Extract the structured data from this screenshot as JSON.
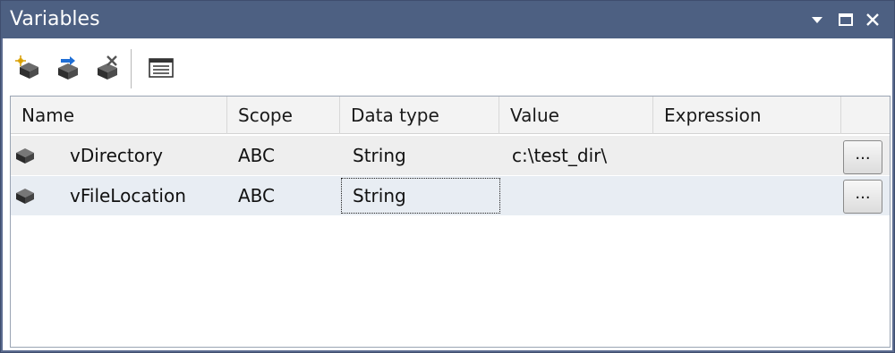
{
  "window": {
    "title": "Variables",
    "title_buttons": [
      "dropdown-arrow",
      "maximize",
      "close"
    ]
  },
  "toolbar": {
    "buttons": [
      {
        "icon": "add-variable-icon"
      },
      {
        "icon": "move-variable-icon"
      },
      {
        "icon": "delete-variable-icon"
      },
      {
        "icon": "grid-options-icon"
      }
    ]
  },
  "grid": {
    "columns": [
      "Name",
      "Scope",
      "Data type",
      "Value",
      "Expression"
    ],
    "rows": [
      {
        "icon": "variable-icon",
        "name": "vDirectory",
        "scope": "ABC",
        "data_type": "String",
        "value": "c:\\test_dir\\",
        "expression": "",
        "button": "..."
      },
      {
        "icon": "variable-icon",
        "name": "vFileLocation",
        "scope": "ABC",
        "data_type": "String",
        "value": "",
        "expression": "",
        "button": "..."
      }
    ]
  },
  "colors": {
    "titlebar": "#4d6082",
    "header_bg": "#f3f3f3",
    "row1_bg": "#eeeeee",
    "row2_bg": "#e8edf3"
  }
}
